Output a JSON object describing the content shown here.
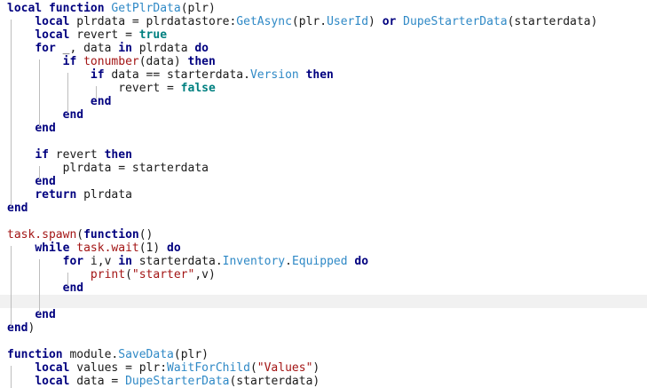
{
  "editor": {
    "highlight_color": "#f1f1f1",
    "colors": {
      "keyword": "#00007f",
      "function": "#2f89c6",
      "string": "#a31515",
      "boolean": "#008080",
      "text": "#1a1a1a"
    },
    "lines": [
      [
        {
          "t": "local function",
          "c": "kw"
        },
        {
          "t": " "
        },
        {
          "t": "GetPlrData",
          "c": "fn"
        },
        {
          "t": "(plr)"
        }
      ],
      [
        {
          "t": "    "
        },
        {
          "t": "local",
          "c": "kw"
        },
        {
          "t": " plrdata = plrdatastore:"
        },
        {
          "t": "GetAsync",
          "c": "fn"
        },
        {
          "t": "(plr."
        },
        {
          "t": "UserId",
          "c": "fn"
        },
        {
          "t": ") "
        },
        {
          "t": "or",
          "c": "kw"
        },
        {
          "t": " "
        },
        {
          "t": "DupeStarterData",
          "c": "fn"
        },
        {
          "t": "(starterdata)"
        }
      ],
      [
        {
          "t": "    "
        },
        {
          "t": "local",
          "c": "kw"
        },
        {
          "t": " revert = "
        },
        {
          "t": "true",
          "c": "bool"
        }
      ],
      [
        {
          "t": "    "
        },
        {
          "t": "for",
          "c": "kw"
        },
        {
          "t": " _, data "
        },
        {
          "t": "in",
          "c": "kw"
        },
        {
          "t": " plrdata "
        },
        {
          "t": "do",
          "c": "kw"
        }
      ],
      [
        {
          "t": "        "
        },
        {
          "t": "if",
          "c": "kw"
        },
        {
          "t": " "
        },
        {
          "t": "tonumber",
          "c": "str"
        },
        {
          "t": "(data) "
        },
        {
          "t": "then",
          "c": "kw"
        }
      ],
      [
        {
          "t": "            "
        },
        {
          "t": "if",
          "c": "kw"
        },
        {
          "t": " data == starterdata."
        },
        {
          "t": "Version",
          "c": "fn"
        },
        {
          "t": " "
        },
        {
          "t": "then",
          "c": "kw"
        }
      ],
      [
        {
          "t": "                revert = "
        },
        {
          "t": "false",
          "c": "bool"
        }
      ],
      [
        {
          "t": "            "
        },
        {
          "t": "end",
          "c": "kw"
        }
      ],
      [
        {
          "t": "        "
        },
        {
          "t": "end",
          "c": "kw"
        }
      ],
      [
        {
          "t": "    "
        },
        {
          "t": "end",
          "c": "kw"
        }
      ],
      [],
      [
        {
          "t": "    "
        },
        {
          "t": "if",
          "c": "kw"
        },
        {
          "t": " revert "
        },
        {
          "t": "then",
          "c": "kw"
        }
      ],
      [
        {
          "t": "        plrdata = starterdata"
        }
      ],
      [
        {
          "t": "    "
        },
        {
          "t": "end",
          "c": "kw"
        }
      ],
      [
        {
          "t": "    "
        },
        {
          "t": "return",
          "c": "kw"
        },
        {
          "t": " plrdata"
        }
      ],
      [
        {
          "t": "end",
          "c": "kw"
        }
      ],
      [],
      [
        {
          "t": "task.",
          "c": "str"
        },
        {
          "t": "spawn",
          "c": "str"
        },
        {
          "t": "("
        },
        {
          "t": "function",
          "c": "kw"
        },
        {
          "t": "()"
        }
      ],
      [
        {
          "t": "    "
        },
        {
          "t": "while",
          "c": "kw"
        },
        {
          "t": " "
        },
        {
          "t": "task.",
          "c": "str"
        },
        {
          "t": "wait",
          "c": "str"
        },
        {
          "t": "(1) "
        },
        {
          "t": "do",
          "c": "kw"
        }
      ],
      [
        {
          "t": "        "
        },
        {
          "t": "for",
          "c": "kw"
        },
        {
          "t": " i,v "
        },
        {
          "t": "in",
          "c": "kw"
        },
        {
          "t": " starterdata."
        },
        {
          "t": "Inventory",
          "c": "fn"
        },
        {
          "t": "."
        },
        {
          "t": "Equipped",
          "c": "fn"
        },
        {
          "t": " "
        },
        {
          "t": "do",
          "c": "kw"
        }
      ],
      [
        {
          "t": "            "
        },
        {
          "t": "print",
          "c": "str"
        },
        {
          "t": "("
        },
        {
          "t": "\"starter\"",
          "c": "str"
        },
        {
          "t": ",v)"
        }
      ],
      [
        {
          "t": "        "
        },
        {
          "t": "end",
          "c": "kw"
        }
      ],
      [],
      [
        {
          "t": "    "
        },
        {
          "t": "end",
          "c": "kw"
        }
      ],
      [
        {
          "t": "end",
          "c": "kw"
        },
        {
          "t": ")"
        }
      ],
      [],
      [
        {
          "t": "function",
          "c": "kw"
        },
        {
          "t": " module."
        },
        {
          "t": "SaveData",
          "c": "fn"
        },
        {
          "t": "(plr)"
        }
      ],
      [
        {
          "t": "    "
        },
        {
          "t": "local",
          "c": "kw"
        },
        {
          "t": " values = plr:"
        },
        {
          "t": "WaitForChild",
          "c": "fn"
        },
        {
          "t": "("
        },
        {
          "t": "\"Values\"",
          "c": "str"
        },
        {
          "t": ")"
        }
      ],
      [
        {
          "t": "    "
        },
        {
          "t": "local",
          "c": "kw"
        },
        {
          "t": " data = "
        },
        {
          "t": "DupeStarterData",
          "c": "fn"
        },
        {
          "t": "(starterdata)"
        }
      ]
    ]
  }
}
